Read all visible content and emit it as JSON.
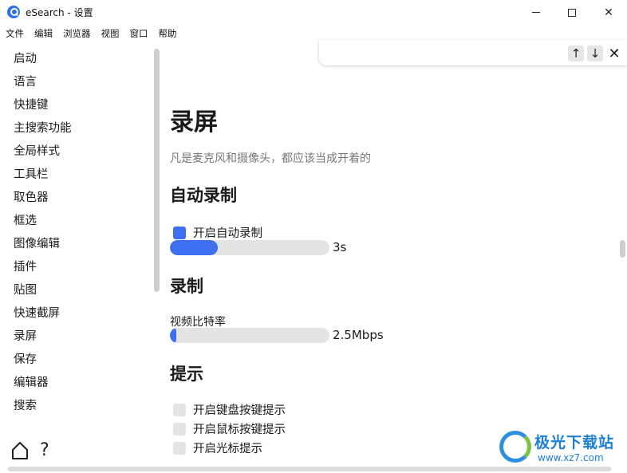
{
  "window": {
    "title": "eSearch - 设置",
    "controls": {
      "minimize": "—",
      "maximize": "☐",
      "close": "✕"
    }
  },
  "menubar": [
    "文件",
    "编辑",
    "浏览器",
    "视图",
    "窗口",
    "帮助"
  ],
  "findbar": {
    "up": "↑",
    "down": "↓",
    "close": "✕"
  },
  "sidebar": {
    "items": [
      "启动",
      "语言",
      "快捷键",
      "主搜索功能",
      "全局样式",
      "工具栏",
      "取色器",
      "框选",
      "图像编辑",
      "插件",
      "贴图",
      "快速截屏",
      "录屏",
      "保存",
      "编辑器",
      "搜索"
    ],
    "help": "?"
  },
  "main": {
    "title": "录屏",
    "description": "凡是麦克风和摄像头，都应该当成开着的",
    "sections": {
      "auto": {
        "heading": "自动录制",
        "checkbox": {
          "label": "开启自动录制",
          "checked": true
        },
        "slider": {
          "fraction": 0.3,
          "value": "3s"
        }
      },
      "record": {
        "heading": "录制",
        "bitrate_label": "视频比特率",
        "slider": {
          "fraction": 0.04,
          "value": "2.5Mbps"
        }
      },
      "hints": {
        "heading": "提示",
        "checkboxes": [
          {
            "label": "开启键盘按键提示",
            "checked": false
          },
          {
            "label": "开启鼠标按键提示",
            "checked": false
          },
          {
            "label": "开启光标提示",
            "checked": false
          }
        ]
      }
    }
  },
  "watermark": {
    "name": "极光下载站",
    "url": "www.xz7.com"
  },
  "colors": {
    "accent": "#3d6ff0",
    "track": "#e4e4e4"
  }
}
